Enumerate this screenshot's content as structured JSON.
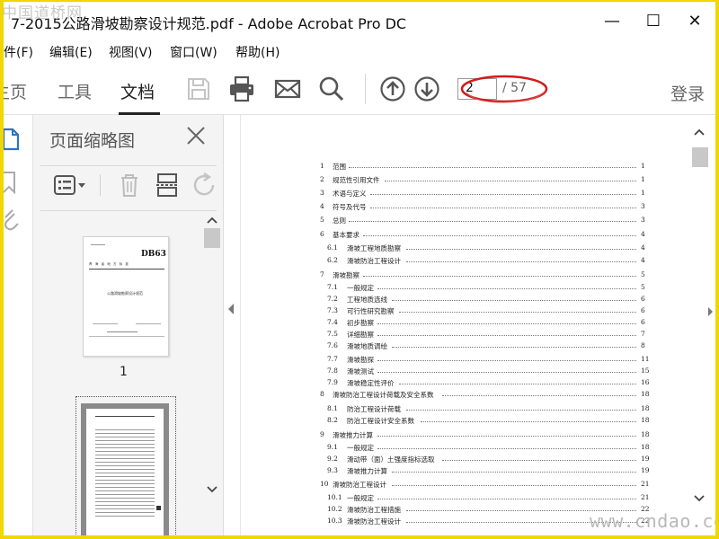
{
  "watermark_top": "中国道桥网",
  "watermark_bottom": "www.cndao.com",
  "window": {
    "title": "7-2015公路滑坡勘察设计规范.pdf - Adobe Acrobat Pro DC",
    "minimize": "—",
    "maximize": "☐",
    "close": "✕"
  },
  "menu": [
    "件(F)",
    "编辑(E)",
    "视图(V)",
    "窗口(W)",
    "帮助(H)"
  ],
  "tabs": {
    "home": "主页",
    "tools": "工具",
    "document": "文档"
  },
  "toolbar": {
    "icons": [
      "save-icon",
      "print-icon",
      "email-icon",
      "search-icon",
      "page-up-icon",
      "page-down-icon"
    ],
    "page_current": "2",
    "page_total": "/ 57",
    "login": "登录",
    "annotation_color": "#d01c1c"
  },
  "thumbnail_panel": {
    "title": "页面缩略图",
    "page1_label": "1",
    "page1_doc": {
      "code": "DB63",
      "subtitle": "青 海 省 地 方 标 准",
      "doc_title": "公路滑坡勘察设计规范"
    }
  },
  "toc": [
    {
      "num": "1",
      "title": "范围",
      "page": "1",
      "indent": 0
    },
    {
      "num": "2",
      "title": "规范性引用文件",
      "page": "1",
      "indent": 0
    },
    {
      "num": "3",
      "title": "术语与定义",
      "page": "1",
      "indent": 0
    },
    {
      "num": "4",
      "title": "符号及代号",
      "page": "3",
      "indent": 0
    },
    {
      "num": "5",
      "title": "总则",
      "page": "3",
      "indent": 0
    },
    {
      "num": "6",
      "title": "基本要求",
      "page": "4",
      "indent": 0
    },
    {
      "num": "6.1",
      "title": "滑坡工程地质勘察",
      "page": "4",
      "indent": 1
    },
    {
      "num": "6.2",
      "title": "滑坡防治工程设计",
      "page": "4",
      "indent": 1
    },
    {
      "num": "7",
      "title": "滑坡勘察",
      "page": "5",
      "indent": 0
    },
    {
      "num": "7.1",
      "title": "一般规定",
      "page": "5",
      "indent": 1
    },
    {
      "num": "7.2",
      "title": "工程地质选线",
      "page": "6",
      "indent": 1
    },
    {
      "num": "7.3",
      "title": "可行性研究勘察",
      "page": "6",
      "indent": 1
    },
    {
      "num": "7.4",
      "title": "初步勘察",
      "page": "6",
      "indent": 1
    },
    {
      "num": "7.5",
      "title": "详细勘察",
      "page": "7",
      "indent": 1
    },
    {
      "num": "7.6",
      "title": "滑坡地质调绘",
      "page": "8",
      "indent": 1
    },
    {
      "num": "7.7",
      "title": "滑坡勘探",
      "page": "11",
      "indent": 1
    },
    {
      "num": "7.8",
      "title": "滑坡测试",
      "page": "15",
      "indent": 1
    },
    {
      "num": "7.9",
      "title": "滑坡稳定性评价",
      "page": "16",
      "indent": 1
    },
    {
      "num": "8",
      "title": "滑坡防治工程设计荷载及安全系数",
      "page": "18",
      "indent": 0
    },
    {
      "num": "8.1",
      "title": "防治工程设计荷载",
      "page": "18",
      "indent": 1
    },
    {
      "num": "8.2",
      "title": "防治工程设计安全系数",
      "page": "18",
      "indent": 1
    },
    {
      "num": "9",
      "title": "滑坡推力计算",
      "page": "18",
      "indent": 0
    },
    {
      "num": "9.1",
      "title": "一般规定",
      "page": "18",
      "indent": 1
    },
    {
      "num": "9.2",
      "title": "滑动带（面）土强度指标选取",
      "page": "19",
      "indent": 1
    },
    {
      "num": "9.3",
      "title": "滑坡推力计算",
      "page": "19",
      "indent": 1
    },
    {
      "num": "10",
      "title": "滑坡防治工程设计",
      "page": "21",
      "indent": 0
    },
    {
      "num": "10.1",
      "title": "一般规定",
      "page": "21",
      "indent": 1
    },
    {
      "num": "10.2",
      "title": "滑坡防治工程措施",
      "page": "22",
      "indent": 1
    },
    {
      "num": "10.3",
      "title": "滑坡防治工程设计",
      "page": "22",
      "indent": 1
    }
  ]
}
